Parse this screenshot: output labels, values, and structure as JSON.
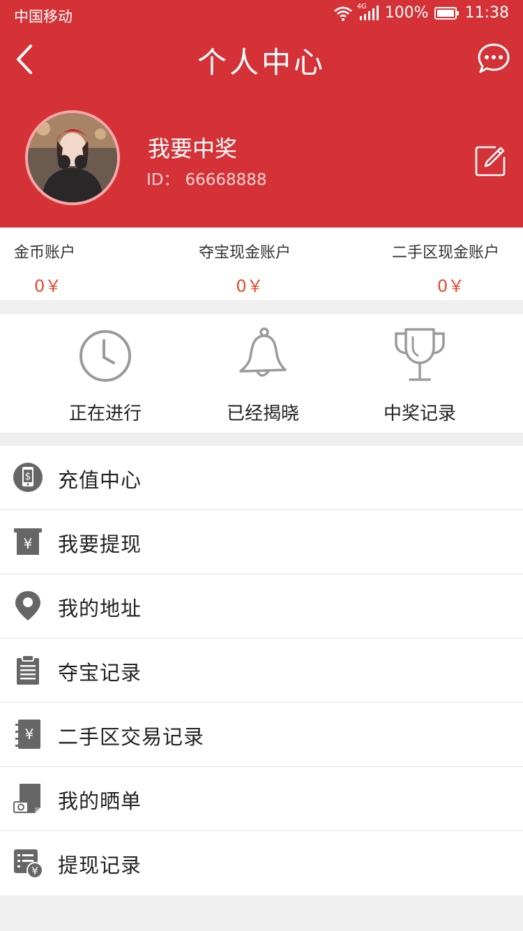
{
  "status_bar": {
    "carrier": "中国移动",
    "network": "4G",
    "battery": "100%",
    "time": "11:38"
  },
  "nav": {
    "title": "个人中心"
  },
  "profile": {
    "name": "我要中奖",
    "id_label": "ID：",
    "id_value": "66668888"
  },
  "accounts": [
    {
      "label": "金币账户",
      "value": "0￥"
    },
    {
      "label": "夺宝现金账户",
      "value": "0￥"
    },
    {
      "label": "二手区现金账户",
      "value": "0￥"
    }
  ],
  "quick_links": [
    {
      "label": "正在进行",
      "icon": "clock-icon"
    },
    {
      "label": "已经揭晓",
      "icon": "bell-icon"
    },
    {
      "label": "中奖记录",
      "icon": "trophy-icon"
    }
  ],
  "menu": [
    {
      "label": "充值中心",
      "icon": "recharge-phone-icon"
    },
    {
      "label": "我要提现",
      "icon": "withdraw-atm-icon"
    },
    {
      "label": "我的地址",
      "icon": "location-pin-icon"
    },
    {
      "label": "夺宝记录",
      "icon": "clipboard-icon"
    },
    {
      "label": "二手区交易记录",
      "icon": "yuan-notebook-icon"
    },
    {
      "label": "我的晒单",
      "icon": "photo-post-icon"
    },
    {
      "label": "提现记录",
      "icon": "withdraw-record-icon"
    }
  ],
  "colors": {
    "header_red": "#d43237",
    "value_orange": "#e84a2a",
    "icon_gray": "#666666"
  }
}
